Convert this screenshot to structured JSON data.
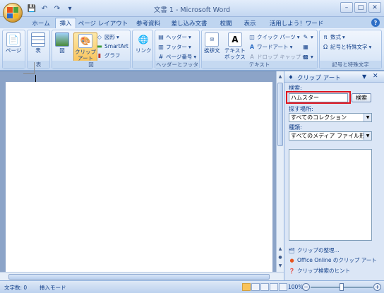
{
  "window": {
    "title": "文書 1 - Microsoft Word",
    "buttons": {
      "minimize": "–",
      "maximize": "□",
      "close": "✕"
    }
  },
  "quick_access": {
    "items": [
      "save-icon",
      "undo-icon",
      "redo-icon",
      "customize-icon"
    ]
  },
  "tabs": [
    "ホーム",
    "挿入",
    "ページ レイアウト",
    "参考資料",
    "差し込み文書",
    "校閲",
    "表示",
    "活用しよう！ワード"
  ],
  "active_tab": "挿入",
  "ribbon": {
    "pages_group": {
      "button": "ページ"
    },
    "table_group": {
      "button": "表",
      "label": "表"
    },
    "illustrations_group": {
      "picture": "図",
      "clipart": "クリップ\nアート",
      "shapes": "図形",
      "smartart": "SmartArt",
      "chart": "グラフ",
      "label": "図"
    },
    "links_group": {
      "button": "リンク"
    },
    "header_footer_group": {
      "header": "ヘッダー",
      "footer": "フッター",
      "page_number": "ページ番号",
      "label": "ヘッダーとフッター"
    },
    "text_group": {
      "greeting": "挨拶文",
      "textbox": "テキスト\nボックス",
      "quick_parts": "クイック パーツ",
      "wordart": "ワードアート",
      "dropcap": "ドロップ キャップ",
      "label": "テキスト"
    },
    "symbols_group": {
      "equation": "数式",
      "symbol": "記号と特殊文字",
      "label": "記号と特殊文字"
    }
  },
  "task_pane": {
    "title": "クリップ アート",
    "search_label": "検索:",
    "search_value": "ハムスター",
    "search_button": "検索",
    "location_label": "探す場所:",
    "location_value": "すべてのコレクション",
    "type_label": "種類:",
    "type_value": "すべてのメディア ファイル形式",
    "links": [
      "クリップの整理...",
      "Office Online のクリップ アート",
      "クリップ検索のヒント"
    ]
  },
  "statusbar": {
    "word_count": "文字数: 0",
    "mode": "挿入モード",
    "zoom": "100%"
  }
}
